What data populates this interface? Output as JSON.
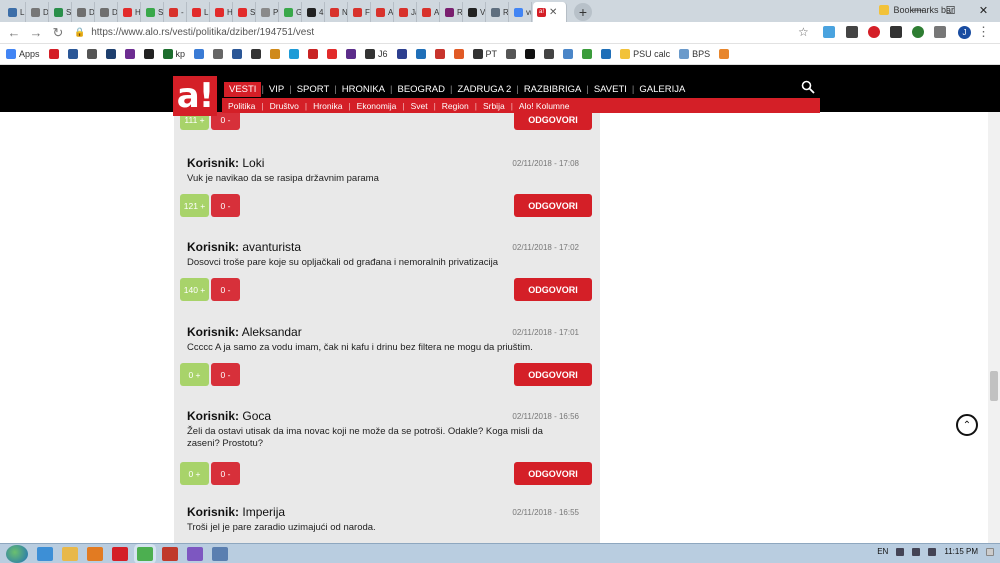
{
  "browser": {
    "tabs": [
      {
        "label": "Lin",
        "color": "#3c6ea8"
      },
      {
        "label": "De",
        "color": "#777777"
      },
      {
        "label": "Sve",
        "color": "#2a8f4a"
      },
      {
        "label": "Dn",
        "color": "#6f6f6f"
      },
      {
        "label": "Dn",
        "color": "#6f6f6f"
      },
      {
        "label": "Ho",
        "color": "#e22b2b"
      },
      {
        "label": "Sm",
        "color": "#39a84a"
      },
      {
        "label": "- R",
        "color": "#d8322c"
      },
      {
        "label": "Lik",
        "color": "#e22b2b"
      },
      {
        "label": "Hc",
        "color": "#e22b2b"
      },
      {
        "label": "SE",
        "color": "#e22b2b"
      },
      {
        "label": "Pri",
        "color": "#8a8a8a"
      },
      {
        "label": "Gh",
        "color": "#39a84a"
      },
      {
        "label": "42",
        "color": "#222222"
      },
      {
        "label": "Ne",
        "color": "#d8322c"
      },
      {
        "label": "Fin",
        "color": "#d8322c"
      },
      {
        "label": "Ali",
        "color": "#d8322c"
      },
      {
        "label": "Jar",
        "color": "#d8322c"
      },
      {
        "label": "Ali",
        "color": "#d8322c"
      },
      {
        "label": "Re",
        "color": "#7a1f6f"
      },
      {
        "label": "Ve",
        "color": "#222222"
      },
      {
        "label": "Re",
        "color": "#5f6f7f"
      },
      {
        "label": "vu",
        "color": "#4285f4"
      }
    ],
    "active_tab_label": "a!",
    "url": "https://www.alo.rs/vesti/politika/dziber/194751/vest",
    "bookmarks": [
      {
        "label": "Apps",
        "color": "#4285f4"
      },
      {
        "label": "",
        "color": "#d41f27"
      },
      {
        "label": "",
        "color": "#2b5797"
      },
      {
        "label": "",
        "color": "#555555"
      },
      {
        "label": "",
        "color": "#1e3f6e"
      },
      {
        "label": "",
        "color": "#6d2c91"
      },
      {
        "label": "",
        "color": "#222222"
      },
      {
        "label": "kp",
        "color": "#1c6d2d"
      },
      {
        "label": "",
        "color": "#3a7bd5"
      },
      {
        "label": "",
        "color": "#666666"
      },
      {
        "label": "",
        "color": "#2b5797"
      },
      {
        "label": "",
        "color": "#333333"
      },
      {
        "label": "",
        "color": "#d08a1a"
      },
      {
        "label": "",
        "color": "#1d9bd7"
      },
      {
        "label": "",
        "color": "#c82323"
      },
      {
        "label": "",
        "color": "#e22b2b"
      },
      {
        "label": "",
        "color": "#5b2c8a"
      },
      {
        "label": "J6",
        "color": "#333333"
      },
      {
        "label": "",
        "color": "#2d3f8f"
      },
      {
        "label": "",
        "color": "#1f6fb8"
      },
      {
        "label": "",
        "color": "#c8342c"
      },
      {
        "label": "",
        "color": "#e15a25"
      },
      {
        "label": "PT",
        "color": "#333333"
      },
      {
        "label": "",
        "color": "#555555"
      },
      {
        "label": "",
        "color": "#111111"
      },
      {
        "label": "",
        "color": "#444444"
      },
      {
        "label": "",
        "color": "#4a86c8"
      },
      {
        "label": "",
        "color": "#3b9c3b"
      },
      {
        "label": "",
        "color": "#1f6fb8"
      },
      {
        "label": "PSU calc",
        "color": "#f2c23a"
      },
      {
        "label": "BPS",
        "color": "#6a9acb"
      },
      {
        "label": "",
        "color": "#e8862c"
      }
    ],
    "bookmarks_bar_label": "Bookmarks bar"
  },
  "site": {
    "logo": "a!",
    "main_nav": [
      "VESTI",
      "VIP",
      "SPORT",
      "HRONIKA",
      "BEOGRAD",
      "ZADRUGA 2",
      "RAZBIBRIGA",
      "SAVETI",
      "GALERIJA"
    ],
    "sub_nav": [
      "Politika",
      "Društvo",
      "Hronika",
      "Ekonomija",
      "Svet",
      "Region",
      "Srbija",
      "Alo! Kolumne"
    ]
  },
  "comments": {
    "author_prefix": "Korisnik:",
    "reply_label": "ODGOVORI",
    "top_partial": {
      "plus": "111 +",
      "minus": "0 -"
    },
    "items": [
      {
        "author": "Loki",
        "date": "02/11/2018 - 17:08",
        "text": "Vuk je navikao da se rasipa državnim parama",
        "plus": "121 +",
        "minus": "0 -"
      },
      {
        "author": "avanturista",
        "date": "02/11/2018 - 17:02",
        "text": "Dosovci troše pare koje su opljačkali od građana i nemoralnih privatizacija",
        "plus": "140 +",
        "minus": "0 -"
      },
      {
        "author": "Aleksandar",
        "date": "02/11/2018 - 17:01",
        "text": "Ccccc A ja samo za vodu imam, čak ni kafu i drinu bez filtera ne mogu da priuštim.",
        "plus": "0 +",
        "minus": "0 -"
      },
      {
        "author": "Goca",
        "date": "02/11/2018 - 16:56",
        "text": "Želi da ostavi utisak da ima novac koji ne može da se potroši. Odakle? Koga misli da zaseni? Prostotu?",
        "plus": "0 +",
        "minus": "0 -"
      },
      {
        "author": "Imperija",
        "date": "02/11/2018 - 16:55",
        "text": "Troši jel je pare zaradio uzimajući od naroda.",
        "plus": "",
        "minus": ""
      }
    ]
  },
  "taskbar": {
    "language": "EN",
    "time": "11:15 PM",
    "icons": [
      {
        "name": "ie-icon",
        "color": "#3d8fd6"
      },
      {
        "name": "explorer-icon",
        "color": "#e8b84a"
      },
      {
        "name": "media-player-icon",
        "color": "#e27b22"
      },
      {
        "name": "opera-icon",
        "color": "#d41f27"
      },
      {
        "name": "chrome-icon",
        "color": "#4caf50"
      },
      {
        "name": "pdf-icon",
        "color": "#c0392b"
      },
      {
        "name": "viber-icon",
        "color": "#7d57c1"
      },
      {
        "name": "app-icon",
        "color": "#5b7fb0"
      }
    ]
  }
}
